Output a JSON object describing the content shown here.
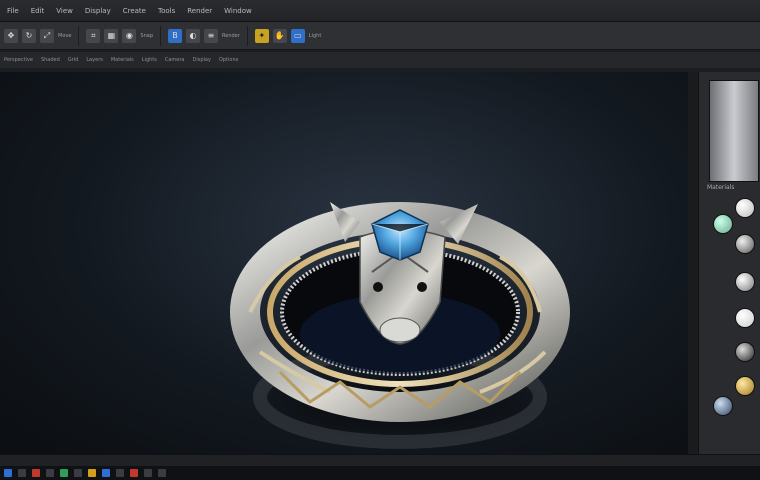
{
  "menubar": {
    "items": [
      "File",
      "Edit",
      "View",
      "Display",
      "Create",
      "Tools",
      "Render",
      "Window"
    ]
  },
  "ribbon": {
    "labels": [
      "Move",
      "Rotate",
      "Scale",
      "Snap",
      "Render",
      "Light"
    ]
  },
  "subbar": {
    "items": [
      "Perspective",
      "Shaded",
      "Grid",
      "Layers",
      "Materials",
      "Lights",
      "Camera",
      "Display",
      "Options"
    ]
  },
  "right_panel": {
    "label": "Materials"
  },
  "colors": {
    "accent": "#2f6fc7",
    "gem": "#5fb8f0",
    "metal": "#c9c9c4"
  }
}
